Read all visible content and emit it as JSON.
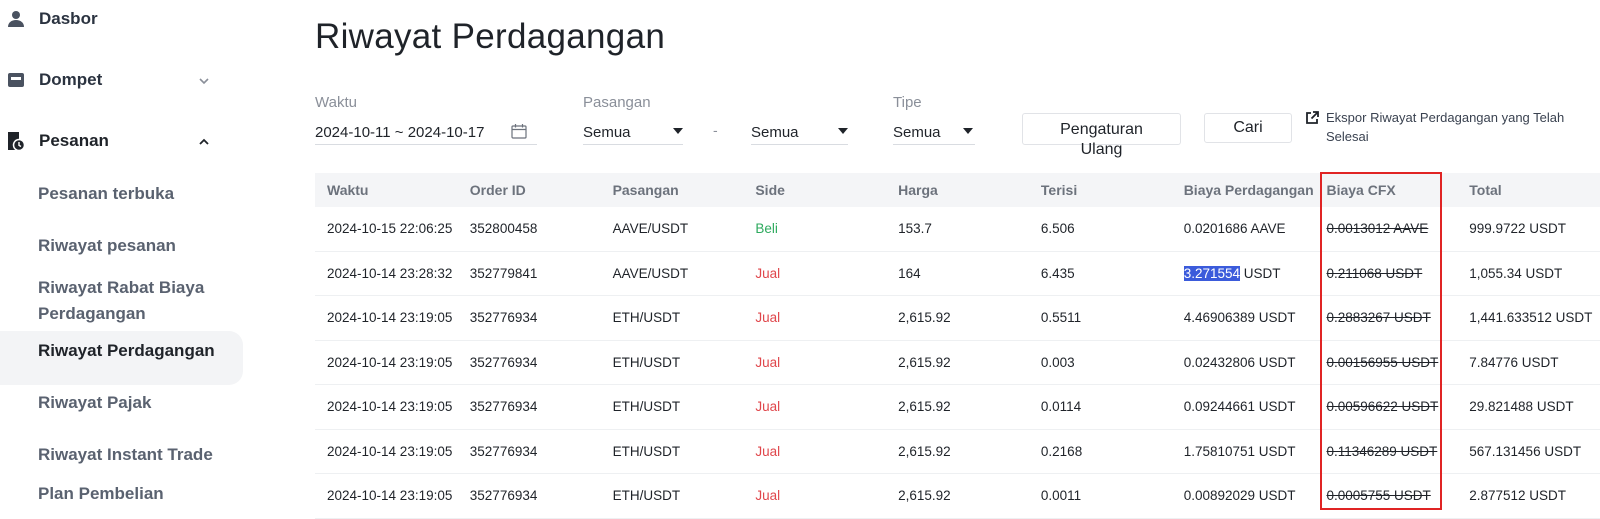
{
  "sidebar": {
    "items": [
      {
        "label": "Dasbor",
        "icon": "user-icon"
      },
      {
        "label": "Dompet",
        "icon": "wallet-icon"
      },
      {
        "label": "Pesanan",
        "icon": "orders-icon"
      }
    ],
    "sub_items": [
      {
        "label": "Pesanan terbuka"
      },
      {
        "label": "Riwayat pesanan"
      },
      {
        "label": "Riwayat Rabat Biaya Perdagangan"
      },
      {
        "label": "Riwayat Perdagangan",
        "active": true
      },
      {
        "label": "Riwayat Pajak"
      },
      {
        "label": "Riwayat Instant Trade"
      },
      {
        "label": "Plan Pembelian"
      }
    ]
  },
  "page": {
    "title": "Riwayat Perdagangan"
  },
  "filters": {
    "time_label": "Waktu",
    "time_value": "2024-10-11 ~ 2024-10-17",
    "pair_label": "Pasangan",
    "pair_base": "Semua",
    "pair_separator": "-",
    "pair_quote": "Semua",
    "type_label": "Tipe",
    "type_value": "Semua",
    "reset_label": "Pengaturan Ulang",
    "search_label": "Cari",
    "export_label": "Ekspor Riwayat Perdagangan yang Telah Selesai"
  },
  "table": {
    "headers": [
      "Waktu",
      "Order ID",
      "Pasangan",
      "Side",
      "Harga",
      "Terisi",
      "Biaya Perdagangan",
      "Biaya CFX",
      "Total"
    ],
    "rows": [
      {
        "time": "2024-10-15 22:06:25",
        "order_id": "352800458",
        "pair": "AAVE/USDT",
        "side": "Beli",
        "price": "153.7",
        "filled": "6.506",
        "fee": "0.0201686 AAVE",
        "fee_hl": "",
        "fee_rest": "",
        "cfx": "0.0013012 AAVE",
        "total": "999.9722 USDT"
      },
      {
        "time": "2024-10-14 23:28:32",
        "order_id": "352779841",
        "pair": "AAVE/USDT",
        "side": "Jual",
        "price": "164",
        "filled": "6.435",
        "fee": "",
        "fee_hl": "3.271554",
        "fee_rest": " USDT",
        "cfx": "0.211068 USDT",
        "total": "1,055.34 USDT"
      },
      {
        "time": "2024-10-14 23:19:05",
        "order_id": "352776934",
        "pair": "ETH/USDT",
        "side": "Jual",
        "price": "2,615.92",
        "filled": "0.5511",
        "fee": "4.46906389 USDT",
        "fee_hl": "",
        "fee_rest": "",
        "cfx": "0.2883267 USDT",
        "total": "1,441.633512 USDT"
      },
      {
        "time": "2024-10-14 23:19:05",
        "order_id": "352776934",
        "pair": "ETH/USDT",
        "side": "Jual",
        "price": "2,615.92",
        "filled": "0.003",
        "fee": "0.02432806 USDT",
        "fee_hl": "",
        "fee_rest": "",
        "cfx": "0.00156955 USDT",
        "total": "7.84776 USDT"
      },
      {
        "time": "2024-10-14 23:19:05",
        "order_id": "352776934",
        "pair": "ETH/USDT",
        "side": "Jual",
        "price": "2,615.92",
        "filled": "0.0114",
        "fee": "0.09244661 USDT",
        "fee_hl": "",
        "fee_rest": "",
        "cfx": "0.00596622 USDT",
        "total": "29.821488 USDT"
      },
      {
        "time": "2024-10-14 23:19:05",
        "order_id": "352776934",
        "pair": "ETH/USDT",
        "side": "Jual",
        "price": "2,615.92",
        "filled": "0.2168",
        "fee": "1.75810751 USDT",
        "fee_hl": "",
        "fee_rest": "",
        "cfx": "0.11346289 USDT",
        "total": "567.131456 USDT"
      },
      {
        "time": "2024-10-14 23:19:05",
        "order_id": "352776934",
        "pair": "ETH/USDT",
        "side": "Jual",
        "price": "2,615.92",
        "filled": "0.0011",
        "fee": "0.00892029 USDT",
        "fee_hl": "",
        "fee_rest": "",
        "cfx": "0.0005755 USDT",
        "total": "2.877512 USDT"
      }
    ]
  },
  "colors": {
    "buy": "#2eaa5e",
    "sell": "#e0474c",
    "highlight_box": "#e02424",
    "selection": "#3b5bdb"
  }
}
